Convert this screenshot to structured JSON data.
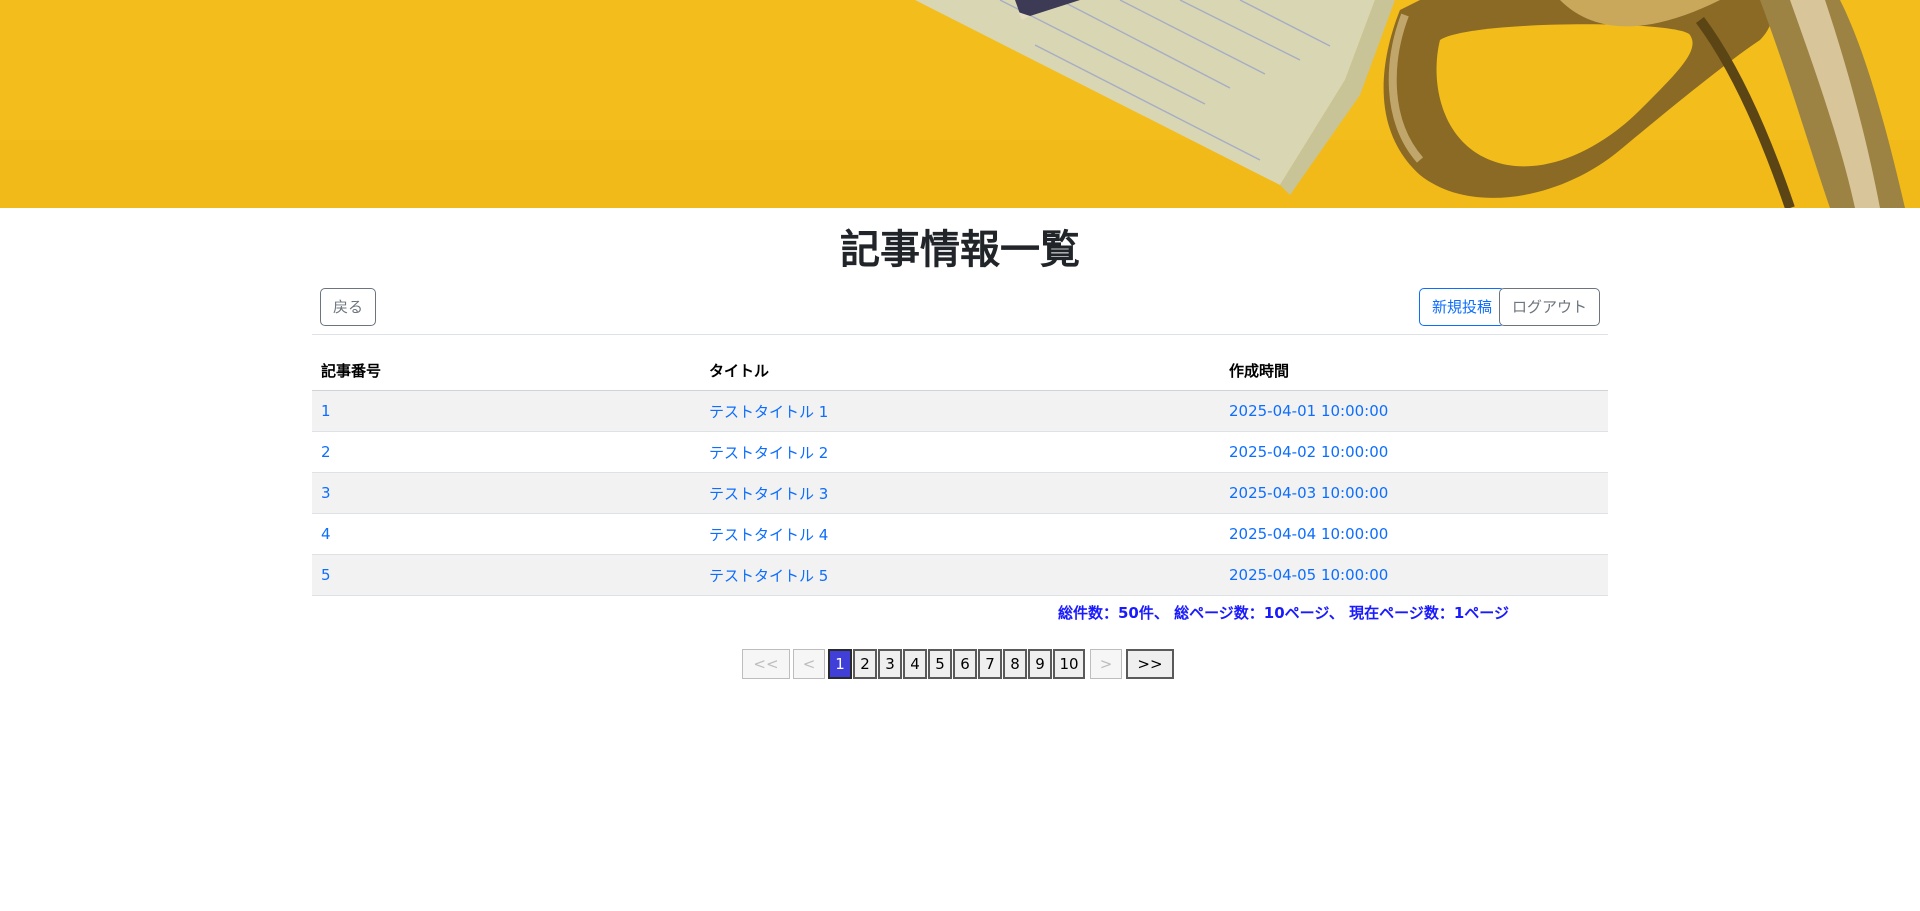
{
  "page": {
    "title": "記事情報一覧"
  },
  "toolbar": {
    "back_label": "戻る",
    "new_post_label": "新規投稿",
    "logout_label": "ログアウト"
  },
  "table": {
    "headers": [
      "記事番号",
      "タイトル",
      "作成時間"
    ],
    "rows": [
      {
        "id": "1",
        "title": "テストタイトル 1",
        "created": "2025-04-01 10:00:00"
      },
      {
        "id": "2",
        "title": "テストタイトル 2",
        "created": "2025-04-02 10:00:00"
      },
      {
        "id": "3",
        "title": "テストタイトル 3",
        "created": "2025-04-03 10:00:00"
      },
      {
        "id": "4",
        "title": "テストタイトル 4",
        "created": "2025-04-04 10:00:00"
      },
      {
        "id": "5",
        "title": "テストタイトル 5",
        "created": "2025-04-05 10:00:00"
      }
    ]
  },
  "summary": {
    "text": "総件数：50件、 総ページ数：10ページ、 現在ページ数：1ページ"
  },
  "pagination": {
    "first_label": "<<",
    "prev_label": "<",
    "next_label": ">",
    "last_label": ">>",
    "pages": [
      "1",
      "2",
      "3",
      "4",
      "5",
      "6",
      "7",
      "8",
      "9",
      "10"
    ],
    "current_page": "1"
  },
  "colors": {
    "hero_background": "#f2bc1b",
    "link": "#0d6efd",
    "summary": "#1a1aff",
    "active_page": "#4040d8"
  }
}
